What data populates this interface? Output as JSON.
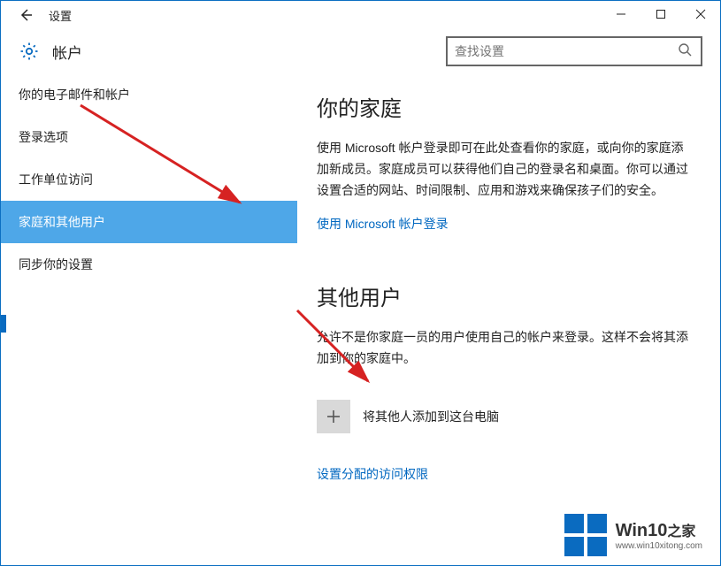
{
  "window": {
    "title": "设置"
  },
  "header": {
    "title": "帐户",
    "search_placeholder": "查找设置"
  },
  "sidebar": {
    "items": [
      {
        "label": "你的电子邮件和帐户"
      },
      {
        "label": "登录选项"
      },
      {
        "label": "工作单位访问"
      },
      {
        "label": "家庭和其他用户"
      },
      {
        "label": "同步你的设置"
      }
    ],
    "selected_index": 3
  },
  "content": {
    "family": {
      "heading": "你的家庭",
      "description": "使用 Microsoft 帐户登录即可在此处查看你的家庭，或向你的家庭添加新成员。家庭成员可以获得他们自己的登录名和桌面。你可以通过设置合适的网站、时间限制、应用和游戏来确保孩子们的安全。",
      "signin_link": "使用 Microsoft 帐户登录"
    },
    "other": {
      "heading": "其他用户",
      "description": "允许不是你家庭一员的用户使用自己的帐户来登录。这样不会将其添加到你的家庭中。",
      "add_label": "将其他人添加到这台电脑",
      "assigned_access_link": "设置分配的访问权限"
    }
  },
  "watermark": {
    "main": "Win10",
    "sub_suffix": "之家",
    "url": "www.win10xitong.com"
  }
}
